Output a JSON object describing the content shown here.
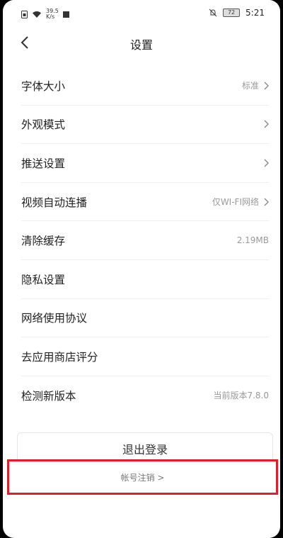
{
  "status_bar": {
    "speed_value": "39.5",
    "speed_unit": "K/s",
    "battery": "72",
    "time": "5:21"
  },
  "header": {
    "title": "设置"
  },
  "settings": [
    {
      "label": "字体大小",
      "value": "标准",
      "chevron": true
    },
    {
      "label": "外观模式",
      "value": "",
      "chevron": true
    },
    {
      "label": "推送设置",
      "value": "",
      "chevron": true
    },
    {
      "label": "视频自动连播",
      "value": "仅WI-FI网络",
      "chevron": true
    },
    {
      "label": "清除缓存",
      "value": "2.19MB",
      "chevron": false
    },
    {
      "label": "隐私设置",
      "value": "",
      "chevron": false
    },
    {
      "label": "网络使用协议",
      "value": "",
      "chevron": false
    },
    {
      "label": "去应用商店评分",
      "value": "",
      "chevron": false
    },
    {
      "label": "检测新版本",
      "value": "当前版本7.8.0",
      "chevron": false
    }
  ],
  "logout_label": "退出登录",
  "account_cancel_label": "帐号注销 >",
  "colors": {
    "highlight_border": "#e01d2a",
    "text_primary": "#222222",
    "text_secondary": "#999999"
  }
}
